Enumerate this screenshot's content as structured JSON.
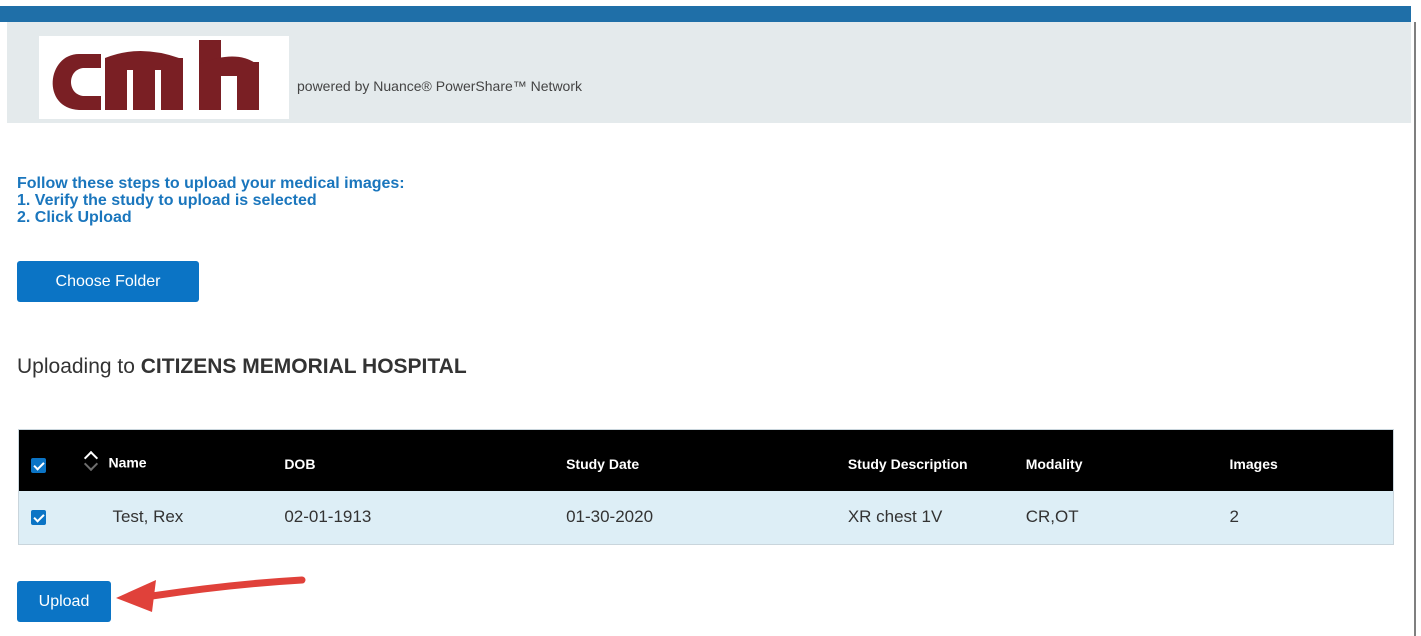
{
  "header": {
    "logo_text": "cmh",
    "powered_by": "powered by Nuance® PowerShare™ Network"
  },
  "instructions": {
    "line1": "Follow these steps to upload your medical images:",
    "line2": "1. Verify the study to upload is selected",
    "line3": "2. Click Upload"
  },
  "choose_folder_label": "Choose Folder",
  "upload_heading": {
    "prefix": "Uploading to ",
    "facility": "CITIZENS MEMORIAL HOSPITAL"
  },
  "table": {
    "columns": {
      "name": "Name",
      "dob": "DOB",
      "study_date": "Study Date",
      "study_description": "Study Description",
      "modality": "Modality",
      "images": "Images"
    },
    "rows": [
      {
        "selected": true,
        "name": "Test, Rex",
        "dob": "02-01-1913",
        "study_date": "01-30-2020",
        "study_description": "XR chest 1V",
        "modality": "CR,OT",
        "images": "2"
      }
    ]
  },
  "upload_label": "Upload",
  "colors": {
    "accent": "#0b74c5",
    "instruction_text": "#1a76bd",
    "top_bar": "#1f6fa8",
    "header_bg": "#e4eaec",
    "logo": "#7a1f24",
    "table_header": "#000000",
    "row_bg": "#ddeef6",
    "annotation_arrow": "#e0413a"
  }
}
